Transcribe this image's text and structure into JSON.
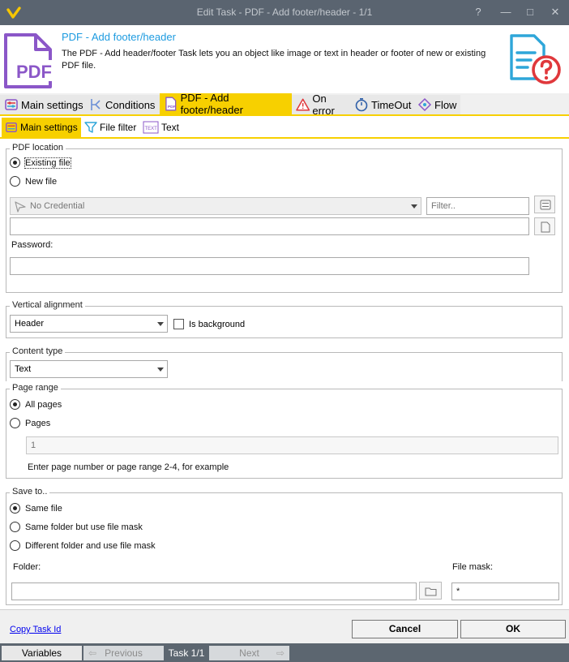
{
  "window": {
    "title": "Edit Task - PDF - Add footer/header - 1/1",
    "controls": {
      "help": "?",
      "minimize": "—",
      "maximize": "□",
      "close": "✕"
    }
  },
  "header": {
    "title": "PDF - Add footer/header",
    "description": "The PDF - Add header/footer Task lets you an object like image or text in header or footer of new or existing PDF file.",
    "icon_text": "PDF"
  },
  "tabs": [
    {
      "label": "Main settings",
      "icon": "sliders-icon"
    },
    {
      "label": "Conditions",
      "icon": "branch-icon"
    },
    {
      "label": "PDF - Add footer/header",
      "icon": "pdf-icon",
      "active": true
    },
    {
      "label": "On error",
      "icon": "warning-icon"
    },
    {
      "label": "TimeOut",
      "icon": "stopwatch-icon"
    },
    {
      "label": "Flow",
      "icon": "flow-icon"
    }
  ],
  "subtabs": [
    {
      "label": "Main settings",
      "icon": "sliders-icon",
      "active": true
    },
    {
      "label": "File filter",
      "icon": "filter-icon"
    },
    {
      "label": "Text",
      "icon": "text-icon",
      "icon_text": "TEXT"
    }
  ],
  "pdf_location": {
    "legend": "PDF location",
    "options": [
      "Existing file",
      "New file"
    ],
    "selected": "Existing file",
    "credential": {
      "value": "No Credential"
    },
    "filter": {
      "placeholder": "Filter.."
    },
    "path": {
      "value": ""
    },
    "password_label": "Password:",
    "password": {
      "value": ""
    }
  },
  "vertical_alignment": {
    "legend": "Vertical alignment",
    "value": "Header",
    "is_background_label": "Is background",
    "is_background": false
  },
  "content_type": {
    "legend": "Content type",
    "value": "Text"
  },
  "page_range": {
    "legend": "Page range",
    "options": [
      "All pages",
      "Pages"
    ],
    "selected": "All pages",
    "pages": {
      "placeholder": "1"
    },
    "hint": "Enter page number or page range 2-4, for example"
  },
  "save_to": {
    "legend": "Save to..",
    "options": [
      "Same file",
      "Same folder but use file mask",
      "Different folder and use file mask"
    ],
    "selected": "Same file",
    "folder_label": "Folder:",
    "folder": {
      "value": ""
    },
    "file_mask_label": "File mask:",
    "file_mask": {
      "value": "*"
    }
  },
  "footer": {
    "copy_task_id": "Copy Task Id",
    "cancel": "Cancel",
    "ok": "OK"
  },
  "nav": {
    "variables": "Variables",
    "previous": "Previous",
    "task_counter": "Task 1/1",
    "next": "Next"
  },
  "colors": {
    "accent_yellow": "#f7d000",
    "title_blue": "#1d9be0",
    "icon_purple": "#8b57c8",
    "help_red": "#e0383c",
    "titlebar": "#5a6470"
  }
}
